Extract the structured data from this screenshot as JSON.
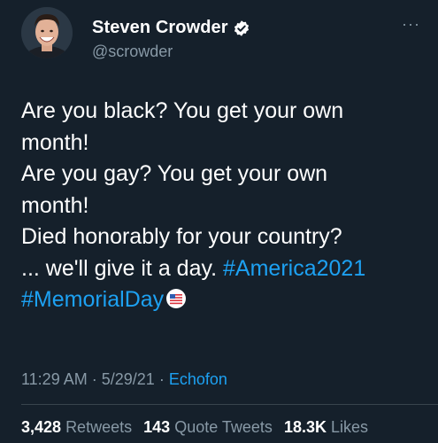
{
  "user": {
    "display_name": "Steven Crowder",
    "handle": "@scrowder",
    "verified": true
  },
  "tweet": {
    "lines": [
      "Are you black? You get your own",
      "month!",
      "Are you gay? You get your own",
      "month!",
      "Died honorably for your country?",
      "... we'll give it a day."
    ],
    "hashtag_1": "#America2021",
    "hashtag_2": "#MemorialDay"
  },
  "meta": {
    "time": "11:29 AM",
    "sep1": "·",
    "date": "5/29/21",
    "sep2": "·",
    "source": "Echofon"
  },
  "stats": {
    "retweets_count": "3,428",
    "retweets_label": "Retweets",
    "quote_count": "143",
    "quote_label": "Quote Tweets",
    "likes_count": "18.3K",
    "likes_label": "Likes"
  },
  "more_label": "···",
  "colors": {
    "background": "#15202b",
    "text": "#ffffff",
    "secondary": "#8899a6",
    "link": "#1da1f2",
    "divider": "#38444d"
  },
  "icons": [
    "avatar-photo",
    "verified-badge-icon",
    "more-options-icon",
    "memorial-day-hashflag-icon"
  ]
}
